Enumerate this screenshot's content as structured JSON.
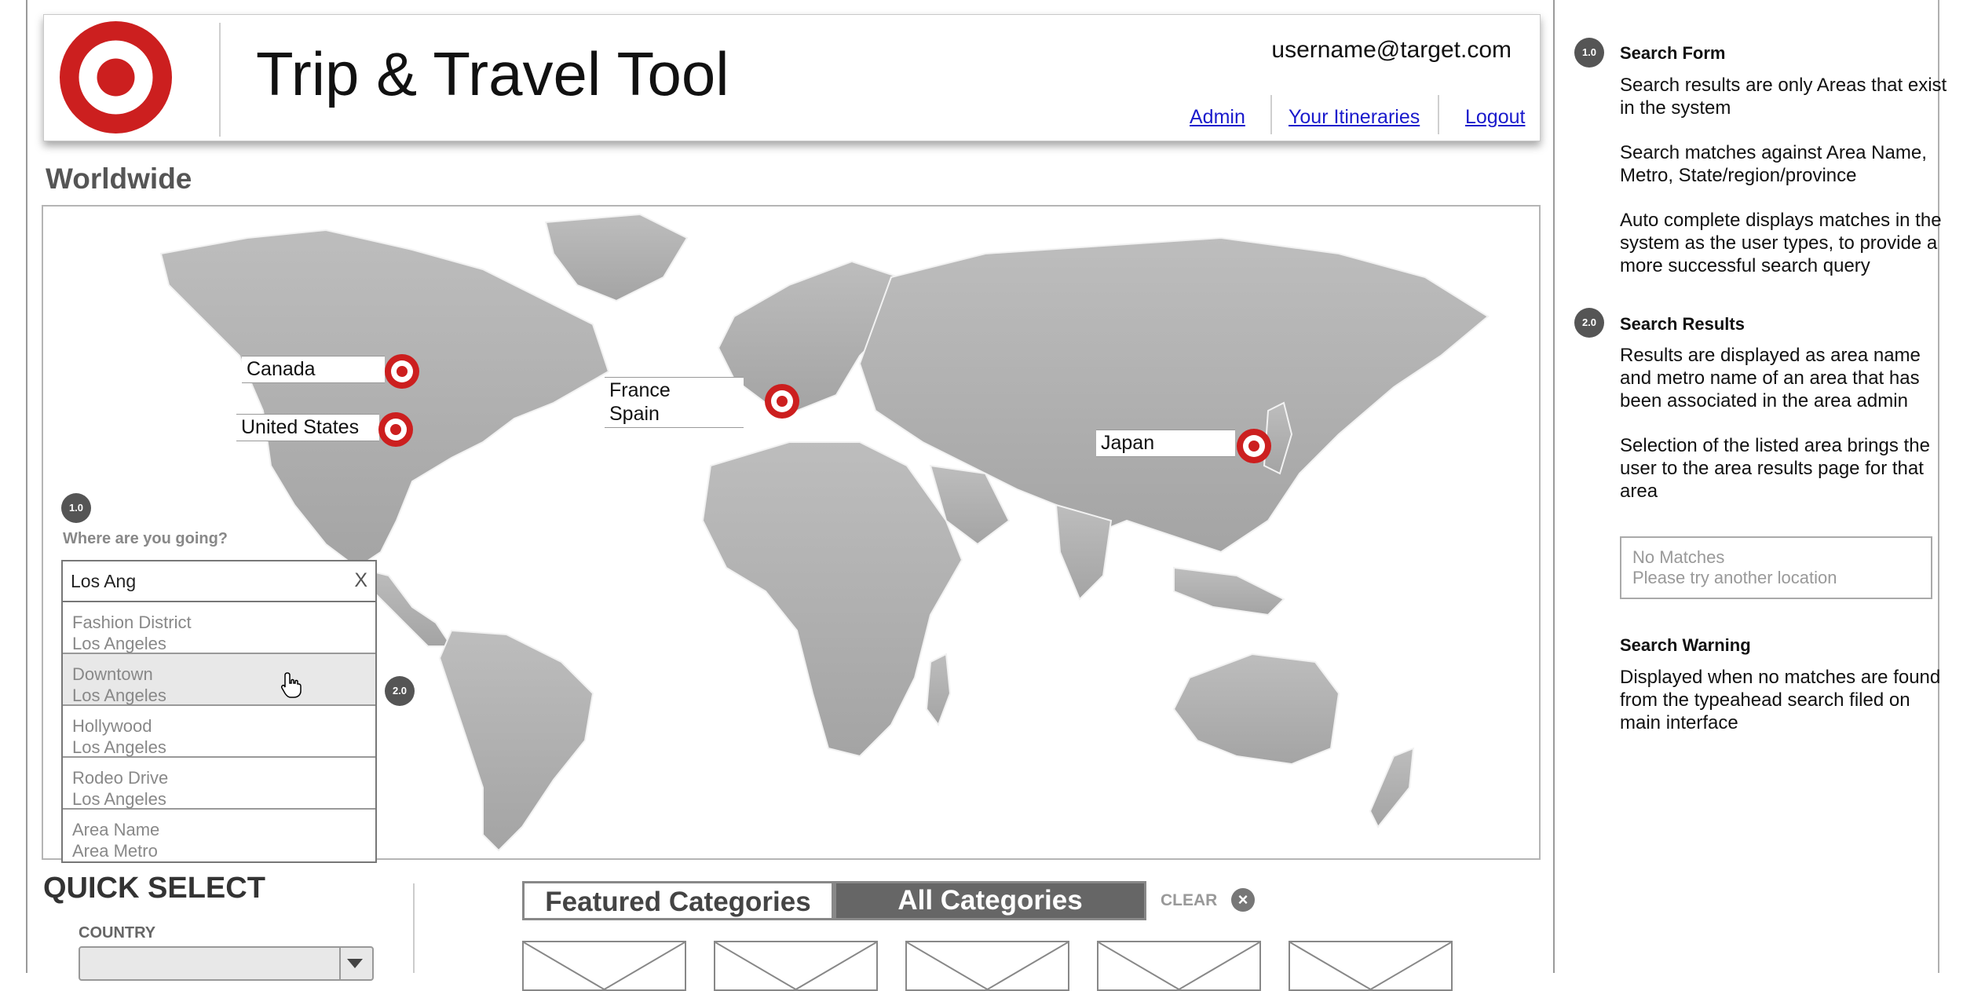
{
  "header": {
    "title": "Trip & Travel Tool",
    "username": "username@target.com",
    "links": [
      "Admin",
      "Your Itineraries",
      "Logout"
    ],
    "logo": "target-logo"
  },
  "map_section": {
    "title": "Worldwide",
    "locations": [
      "Canada",
      "United States",
      "France",
      "Spain",
      "Japan"
    ],
    "pin_icon": "target-pin-icon"
  },
  "search": {
    "badge": "1.0",
    "prompt": "Where are you going?",
    "value": "Los Ang",
    "clear_label": "X",
    "results_badge": "2.0",
    "results": [
      {
        "area": "Fashion District",
        "metro": "Los Angeles"
      },
      {
        "area": "Downtown",
        "metro": "Los Angeles"
      },
      {
        "area": "Hollywood",
        "metro": "Los Angeles"
      },
      {
        "area": "Rodeo Drive",
        "metro": "Los Angeles"
      },
      {
        "area": "Area Name",
        "metro": "Area Metro"
      }
    ]
  },
  "quick_select": {
    "title": "QUICK SELECT",
    "country_label": "COUNTRY"
  },
  "categories": {
    "featured_tab": "Featured Categories",
    "all_tab": "All Categories",
    "clear_label": "CLEAR"
  },
  "notes": {
    "search_form": {
      "badge": "1.0",
      "title": "Search Form",
      "p1": "Search results are only Areas that exist in the system",
      "p2": "Search matches against Area Name, Metro, State/region/province",
      "p3": "Auto complete displays matches in the system as the user types, to provide a more successful search query"
    },
    "search_results": {
      "badge": "2.0",
      "title": "Search Results",
      "p1": "Results are displayed as area name and metro name of an area that has been associated in the area admin",
      "p2": "Selection of the listed area brings the user to the area results page for that area"
    },
    "no_match": {
      "line1": "No Matches",
      "line2": "Please try another location"
    },
    "search_warning": {
      "title": "Search Warning",
      "p1": "Displayed when no matches are found from the typeahead search filed on main interface"
    }
  },
  "colors": {
    "brand_red": "#cc1f1f",
    "link_blue": "#1a1acc",
    "badge_gray": "#555555",
    "tab_active": "#666666"
  }
}
